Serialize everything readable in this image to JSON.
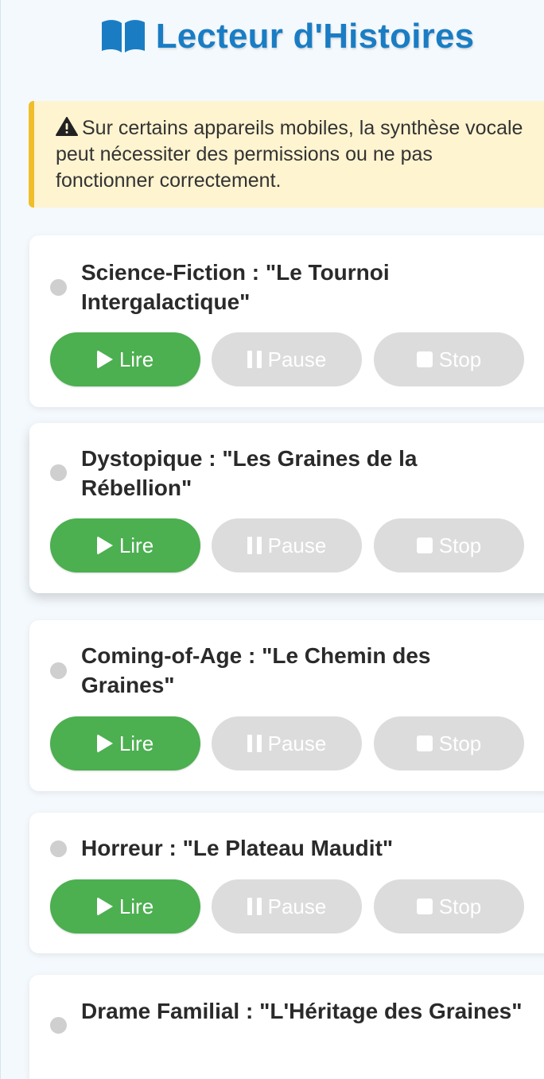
{
  "header": {
    "title": "Lecteur d'Histoires",
    "icon": "open-book-icon",
    "color": "#1a7dc4"
  },
  "warning": {
    "icon": "warning-icon",
    "text": "Sur certains appareils mobiles, la synthèse vocale peut nécessiter des permissions ou ne pas fonctionner correctement."
  },
  "buttons": {
    "play_label": "Lire",
    "pause_label": "Pause",
    "stop_label": "Stop"
  },
  "stories": [
    {
      "title": "Science-Fiction : \"Le Tournoi Intergalactique\""
    },
    {
      "title": "Dystopique : \"Les Graines de la Rébellion\""
    },
    {
      "title": "Coming-of-Age : \"Le Chemin des Graines\""
    },
    {
      "title": "Horreur : \"Le Plateau Maudit\""
    },
    {
      "title": "Drame Familial : \"L'Héritage des Graines\""
    }
  ],
  "colors": {
    "play": "#4caf50",
    "disabled": "#dcdcdc",
    "warning_bg": "#fff4d0",
    "warning_border": "#f0be2a"
  }
}
